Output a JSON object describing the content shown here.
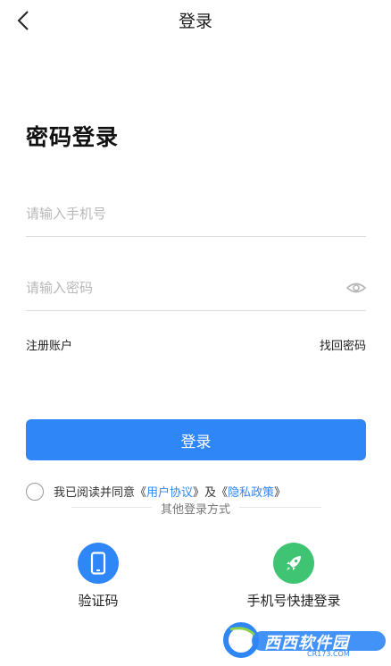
{
  "header": {
    "title": "登录",
    "back_icon": "chevron-left-icon"
  },
  "login": {
    "heading": "密码登录",
    "phone_placeholder": "请输入手机号",
    "password_placeholder": "请输入密码",
    "register_link": "注册账户",
    "forgot_link": "找回密码",
    "submit_label": "登录"
  },
  "agreement": {
    "prefix": "我已阅读并同意",
    "bracket_open": "《",
    "bracket_close": "》",
    "user_agreement": "用户协议",
    "conjunction": "及",
    "privacy_policy": "隐私政策"
  },
  "other": {
    "label": "其他登录方式",
    "options": [
      {
        "label": "验证码",
        "icon": "phone-icon",
        "color": "#2f86f6"
      },
      {
        "label": "手机号快捷登录",
        "icon": "rocket-icon",
        "color": "#3fc473"
      }
    ]
  },
  "watermark": {
    "text": "西西软件园",
    "sub": "CR173.COM"
  },
  "colors": {
    "accent": "#2f86f6",
    "green": "#3fc473"
  }
}
